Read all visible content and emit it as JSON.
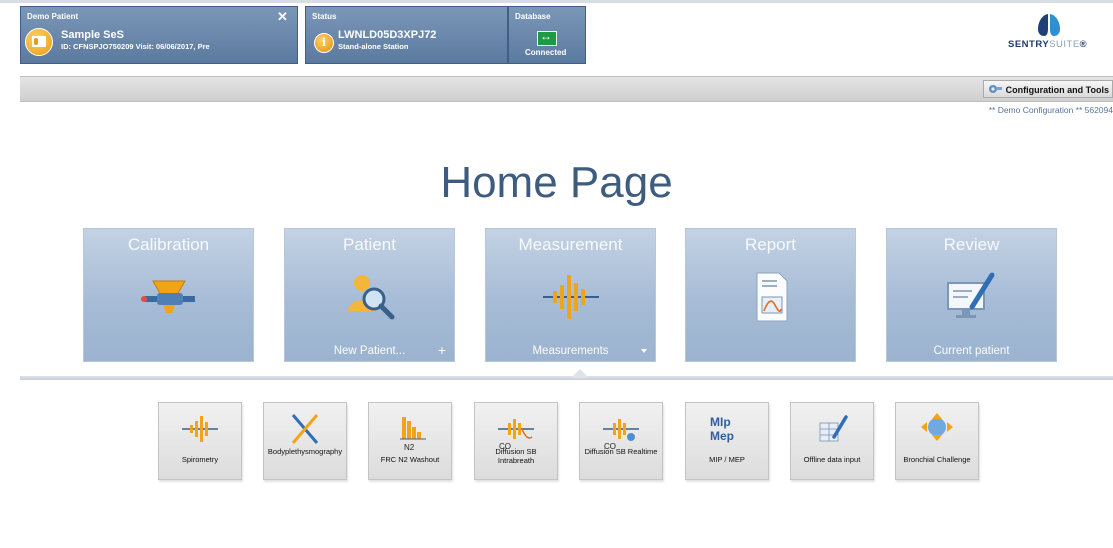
{
  "patient_panel": {
    "title": "Demo Patient",
    "name": "Sample SeS",
    "details": "ID: CFNSPJO750209 Visit: 06/06/2017, Pre",
    "close": "✕"
  },
  "status_panel": {
    "title": "Status",
    "station_id": "LWNLD05D3XPJ72",
    "station_type": "Stand-alone Station",
    "info_glyph": "i"
  },
  "database_panel": {
    "title": "Database",
    "state": "Connected"
  },
  "brand": {
    "name_a": "SENTRY",
    "name_b": "SUITE",
    "reg": "®"
  },
  "toolbar": {
    "config_label": "Configuration and Tools"
  },
  "config_info": "** Demo Configuration **  562094",
  "page_title": "Home Page",
  "tiles": [
    {
      "title": "Calibration",
      "footer": "",
      "icon": "calibration-icon"
    },
    {
      "title": "Patient",
      "footer": "New Patient...",
      "extra": "+",
      "icon": "patient-search-icon"
    },
    {
      "title": "Measurement",
      "footer": "Measurements",
      "icon": "waveform-icon"
    },
    {
      "title": "Report",
      "footer": "",
      "icon": "report-icon"
    },
    {
      "title": "Review",
      "footer": "Current patient",
      "icon": "review-icon"
    }
  ],
  "measurements": [
    {
      "label": "Spirometry"
    },
    {
      "label": "Bodyplethysmography"
    },
    {
      "label": "FRC N2 Washout",
      "overlay": "N2"
    },
    {
      "label": "Diffusion SB Intrabreath",
      "overlay": "CO"
    },
    {
      "label": "Diffusion SB Realtime",
      "overlay": "CO"
    },
    {
      "label": "MIP / MEP",
      "overlay_top": "MIp",
      "overlay_bottom": "Mep"
    },
    {
      "label": "Offline data input"
    },
    {
      "label": "Bronchial Challenge"
    }
  ],
  "colors": {
    "header_blue": "#5b7a9f",
    "tile_blue": "#a6bcd6",
    "title_text": "#3e5d7e",
    "icon_orange": "#f0a41a",
    "db_green": "#1e9a44"
  }
}
